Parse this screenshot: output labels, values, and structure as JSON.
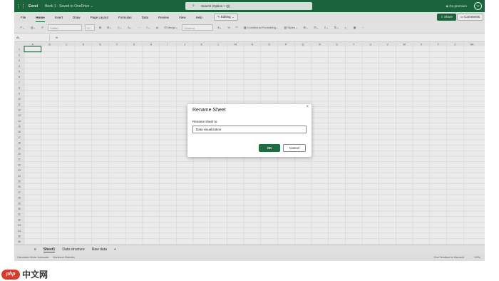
{
  "titlebar": {
    "app_name": "Excel",
    "book_status": "Book 1 · Saved to OneDrive ⌄",
    "search_placeholder": "Search (Option + Q)",
    "go_premium": "Go premium",
    "avatar_initials": "TT"
  },
  "menu": {
    "items": [
      "File",
      "Home",
      "Insert",
      "Draw",
      "Page Layout",
      "Formulas",
      "Data",
      "Review",
      "View",
      "Help"
    ],
    "editing": "Editing ⌄",
    "share": "Share",
    "comments": "Comments"
  },
  "ribbon": {
    "font": "Calibri",
    "font_size": "11",
    "merge": "Merge",
    "number_format": "General",
    "conditional_formatting": "Conditional Formatting",
    "styles": "Styles"
  },
  "formula_bar": {
    "cell_ref": "A1",
    "fx": "fx"
  },
  "grid": {
    "columns": [
      "A",
      "B",
      "C",
      "D",
      "E",
      "F",
      "G",
      "H",
      "I",
      "J",
      "K",
      "L",
      "M",
      "N",
      "O",
      "P",
      "Q",
      "R",
      "S",
      "T",
      "U",
      "V",
      "W",
      "X",
      "Y",
      "Z",
      "AA"
    ],
    "row_count": 36
  },
  "sheets": {
    "tabs": [
      "Sheet1",
      "Data structure",
      "Raw data"
    ],
    "add": "+",
    "menu": "≡"
  },
  "status": {
    "calc_mode": "Calculation Mode: Automatic",
    "workbook_stats": "Workbook Statistics",
    "feedback": "Give Feedback to Microsoft",
    "zoom": "100%"
  },
  "dialog": {
    "title": "Rename Sheet",
    "close": "×",
    "label": "Rename sheet to:",
    "value": "Data visualization",
    "ok": "OK",
    "cancel": "Cancel"
  },
  "watermark": {
    "logo": "php",
    "text": "中文网"
  },
  "colors": {
    "brand": "#1e6c41"
  }
}
